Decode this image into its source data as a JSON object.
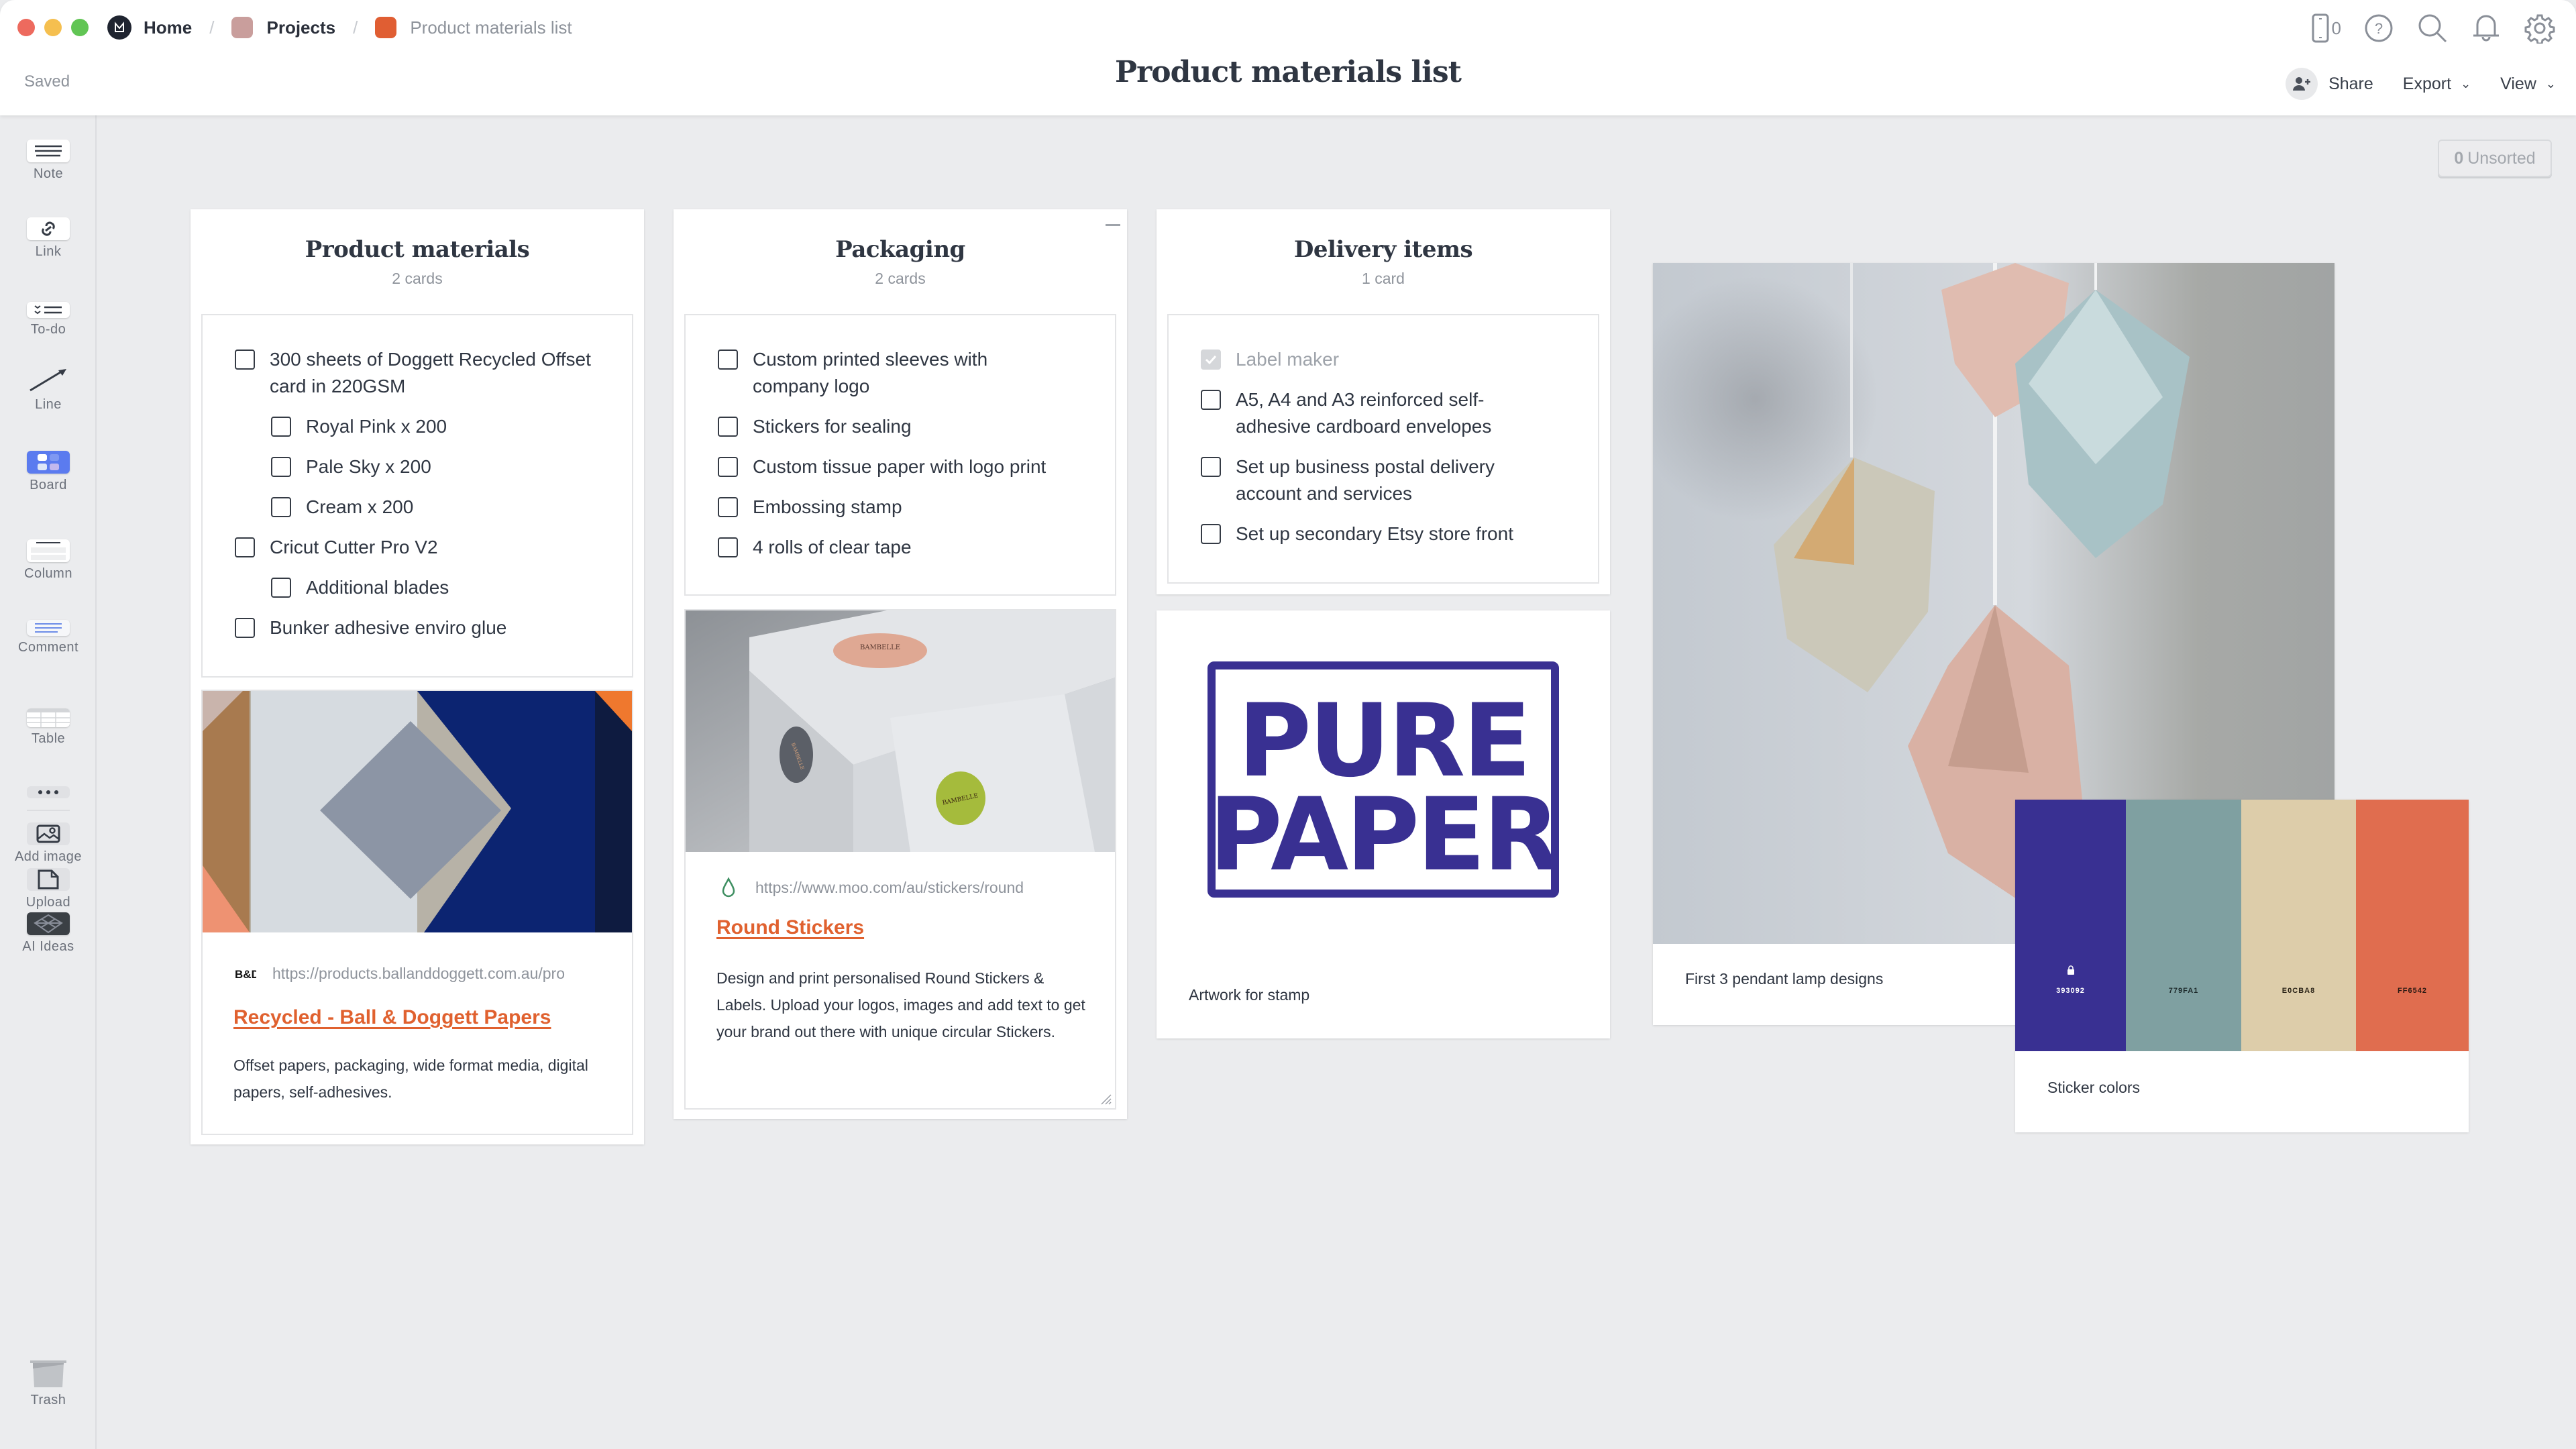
{
  "window": {
    "breadcrumbs": [
      {
        "label": "Home",
        "color": "#1f2430"
      },
      {
        "label": "Projects",
        "color": "#c99e9c"
      },
      {
        "label": "Product materials list",
        "color": "#e05e33"
      }
    ],
    "save_status": "Saved",
    "title": "Product materials list",
    "device_count": "0",
    "actions": {
      "share": "Share",
      "export": "Export",
      "view": "View"
    }
  },
  "sidebar": {
    "tools": [
      {
        "label": "Note",
        "icon": "note-icon"
      },
      {
        "label": "Link",
        "icon": "link-icon"
      },
      {
        "label": "To-do",
        "icon": "todo-icon"
      },
      {
        "label": "Line",
        "icon": "line-arrow-icon"
      },
      {
        "label": "Board",
        "icon": "board-icon"
      },
      {
        "label": "Column",
        "icon": "column-icon"
      },
      {
        "label": "Comment",
        "icon": "comment-icon"
      },
      {
        "label": "Table",
        "icon": "table-icon"
      },
      {
        "label": "",
        "icon": "more-icon"
      },
      {
        "label": "Add image",
        "icon": "add-image-icon"
      },
      {
        "label": "Upload",
        "icon": "upload-file-icon"
      },
      {
        "label": "AI Ideas",
        "icon": "ai-ideas-icon"
      },
      {
        "label": "Trash",
        "icon": "trash-icon"
      }
    ]
  },
  "board": {
    "unsorted": {
      "count": "0",
      "label": "Unsorted"
    },
    "columns": [
      {
        "title": "Product materials",
        "count": "2 cards",
        "todos": [
          {
            "text": "300 sheets of Doggett Recycled Offset card in 220GSM",
            "checked": false,
            "indent": 0
          },
          {
            "text": "Royal Pink x 200",
            "checked": false,
            "indent": 1
          },
          {
            "text": "Pale Sky x 200",
            "checked": false,
            "indent": 1
          },
          {
            "text": "Cream x 200",
            "checked": false,
            "indent": 1
          },
          {
            "text": "Cricut Cutter Pro V2",
            "checked": false,
            "indent": 0
          },
          {
            "text": "Additional blades",
            "checked": false,
            "indent": 1
          },
          {
            "text": "Bunker adhesive enviro glue",
            "checked": false,
            "indent": 0
          }
        ],
        "link": {
          "favicon": "B&D",
          "url": "https://products.ballanddoggett.com.au/pro",
          "title": "Recycled - Ball & Doggett Papers",
          "description": "Offset papers, packaging, wide format media, digital papers, self-adhesives."
        }
      },
      {
        "title": "Packaging",
        "count": "2 cards",
        "todos": [
          {
            "text": "Custom printed sleeves with company logo",
            "checked": false,
            "indent": 0
          },
          {
            "text": "Stickers for sealing",
            "checked": false,
            "indent": 0
          },
          {
            "text": "Custom tissue paper with logo print",
            "checked": false,
            "indent": 0
          },
          {
            "text": "Embossing stamp",
            "checked": false,
            "indent": 0
          },
          {
            "text": "4 rolls of clear tape",
            "checked": false,
            "indent": 0
          }
        ],
        "link": {
          "favicon": "moo-drop",
          "url": "https://www.moo.com/au/stickers/round",
          "title": "Round Stickers",
          "description": "Design and print personalised Round Stickers & Labels. Upload your logos, images and add text to get your brand out there with unique circular Stickers.",
          "image_text": [
            "BAMBELLE",
            "BAMBELLE",
            "BAMBELLE"
          ]
        }
      },
      {
        "title": "Delivery items",
        "count": "1 card",
        "todos": [
          {
            "text": "Label maker",
            "checked": true,
            "indent": 0
          },
          {
            "text": "A5, A4 and A3 reinforced self-adhesive cardboard envelopes",
            "checked": false,
            "indent": 0
          },
          {
            "text": "Set up business postal delivery account and services",
            "checked": false,
            "indent": 0
          },
          {
            "text": "Set up secondary Etsy store front",
            "checked": false,
            "indent": 0
          }
        ],
        "image_card": {
          "logo_lines": [
            "PURE",
            "PAPER"
          ],
          "logo_color": "#393092",
          "caption": "Artwork for stamp"
        }
      }
    ],
    "lamp_card": {
      "caption": "First 3 pendant lamp designs"
    },
    "swatch_card": {
      "caption": "Sticker colors",
      "swatches": [
        {
          "hex": "393092",
          "color": "#393092",
          "text_color": "#ffffff",
          "locked": true
        },
        {
          "hex": "779FA1",
          "color": "#7fa0a1",
          "text_color": "#1d2a2b",
          "locked": false
        },
        {
          "hex": "E0CBA8",
          "color": "#ddcdaa",
          "text_color": "#2a2317",
          "locked": false
        },
        {
          "hex": "FF6542",
          "color": "#e06d4f",
          "text_color": "#2a1a14",
          "locked": false
        }
      ]
    }
  },
  "colors": {
    "accent_link": "#e0612f",
    "canvas": "#ebecee",
    "board_tool": "#5b7bef"
  }
}
